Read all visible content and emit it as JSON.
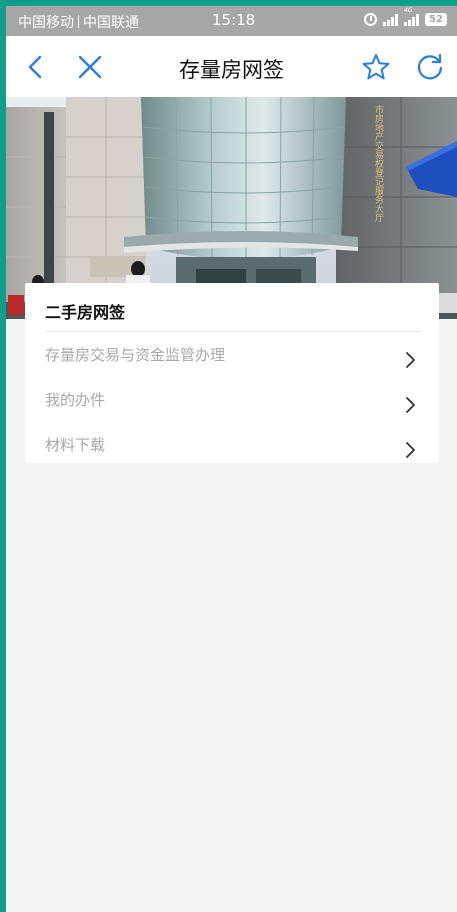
{
  "status_bar": {
    "carrier1": "中国移动",
    "carrier2": "中国联通",
    "time": "15:18",
    "network_tag": "4G",
    "battery": "52"
  },
  "nav": {
    "title": "存量房网签",
    "icons": [
      "back-icon",
      "close-icon",
      "star-icon",
      "refresh-icon"
    ],
    "accent_color": "#2b7de0"
  },
  "banner": {
    "sign_text": "市房地产交易权登记服务大厅"
  },
  "card": {
    "title": "二手房网签",
    "items": [
      {
        "label": "存量房交易与资金监管办理"
      },
      {
        "label": "我的办件"
      },
      {
        "label": "材料下载"
      }
    ]
  }
}
